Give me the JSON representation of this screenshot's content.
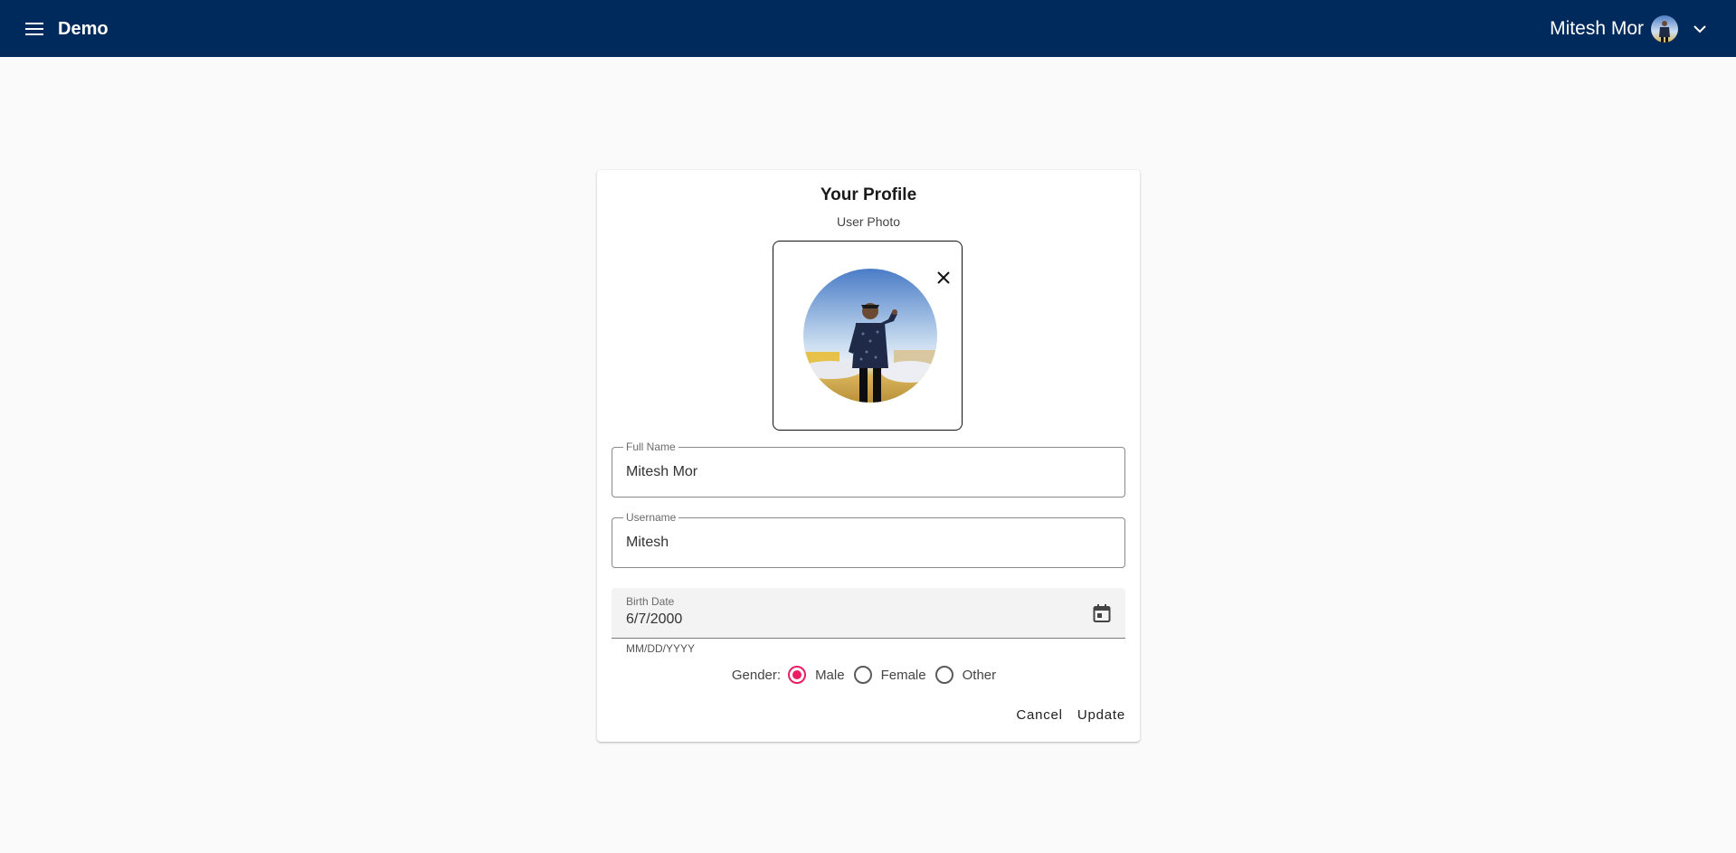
{
  "header": {
    "app_title": "Demo",
    "user_name": "Mitesh Mor",
    "bg_color": "#002a5c"
  },
  "profile": {
    "title": "Your Profile",
    "photo_caption": "User Photo",
    "full_name": {
      "label": "Full Name",
      "value": "Mitesh Mor"
    },
    "username": {
      "label": "Username",
      "value": "Mitesh"
    },
    "birth_date": {
      "label": "Birth Date",
      "value": "6/7/2000",
      "hint": "MM/DD/YYYY"
    },
    "gender": {
      "label": "Gender:",
      "options": [
        "Male",
        "Female",
        "Other"
      ],
      "selected": "Male"
    },
    "actions": {
      "cancel": "Cancel",
      "update": "Update"
    },
    "accent_color": "#e91e63"
  }
}
